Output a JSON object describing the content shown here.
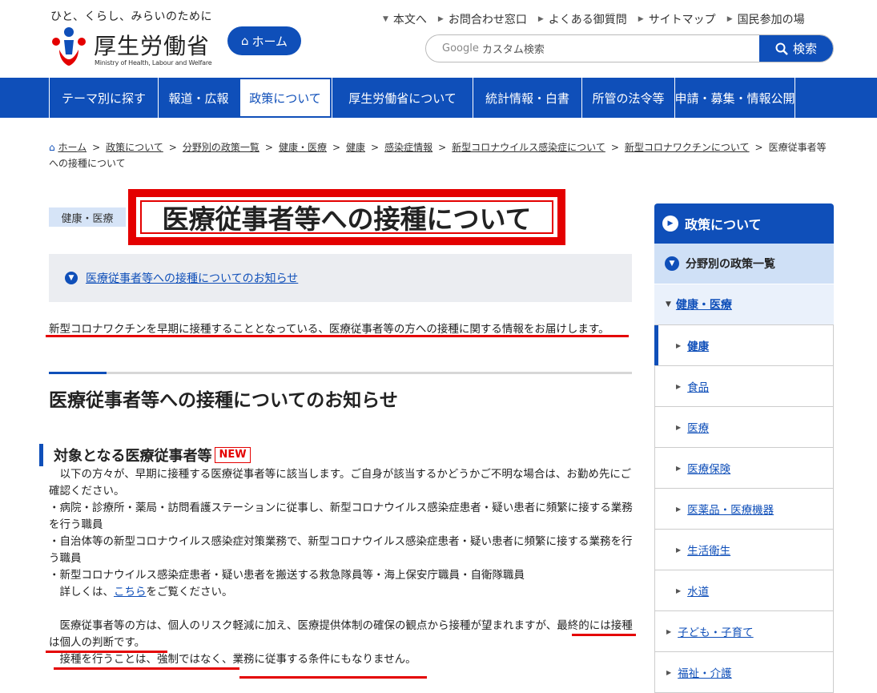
{
  "header": {
    "tagline": "ひと、くらし、みらいのために",
    "logo_name": "厚生労働省",
    "logo_en": "Ministry of Health, Labour and Welfare",
    "home_label": "ホーム",
    "top_links": [
      "本文へ",
      "お問合わせ窓口",
      "よくある御質問",
      "サイトマップ",
      "国民参加の場"
    ],
    "search_brand": "Google",
    "search_placeholder": "カスタム検索",
    "search_button": "検索"
  },
  "nav": {
    "items": [
      "テーマ別に探す",
      "報道・広報",
      "政策について",
      "厚生労働省について",
      "統計情報・白書",
      "所管の法令等",
      "申請・募集・情報公開"
    ],
    "active_index": 2
  },
  "breadcrumb": {
    "items": [
      "ホーム",
      "政策について",
      "分野別の政策一覧",
      "健康・医療",
      "健康",
      "感染症情報",
      "新型コロナウイルス感染症について",
      "新型コロナワクチンについて"
    ],
    "current": "医療従事者等への接種について"
  },
  "main": {
    "category_tag": "健康・医療",
    "title": "医療従事者等への接種について",
    "anchor_link": "医療従事者等への接種についてのお知らせ",
    "lead": "新型コロナワクチンを早期に接種することとなっている、医療従事者等の方への接種に関する情報をお届けします。",
    "h2": "医療従事者等への接種についてのお知らせ",
    "h3": "対象となる医療従事者等",
    "new_badge": "NEW",
    "para1": "　以下の方々が、早期に接種する医療従事者等に該当します。ご自身が該当するかどうかご不明な場合は、お勤め先にご確認ください。",
    "bullet1": "・病院・診療所・薬局・訪問看護ステーションに従事し、新型コロナウイルス感染症患者・疑い患者に頻繁に接する業務を行う職員",
    "bullet2": "・自治体等の新型コロナウイルス感染症対策業務で、新型コロナウイルス感染症患者・疑い患者に頻繁に接する業務を行う職員",
    "bullet3": "・新型コロナウイルス感染症患者・疑い患者を搬送する救急隊員等・海上保安庁職員・自衛隊職員",
    "details_prefix": "　詳しくは、",
    "details_link": "こちら",
    "details_suffix": "をご覧ください。",
    "para2": "　医療従事者等の方は、個人のリスク軽減に加え、医療提供体制の確保の観点から接種が望まれますが、最終的には接種は個人の判断です。",
    "para3": "　接種を行うことは、強制ではなく、業務に従事する条件にもなりません。"
  },
  "sidebar": {
    "head": "政策について",
    "sub": "分野別の政策一覧",
    "category": "健康・医療",
    "items": [
      "健康",
      "食品",
      "医療",
      "医療保険",
      "医薬品・医療機器",
      "生活衛生",
      "水道"
    ],
    "current_index": 0,
    "top_items": [
      "子ども・子育て",
      "福祉・介護"
    ]
  },
  "colors": {
    "brand_blue": "#0f4fb9",
    "highlight_red": "#e40000"
  }
}
